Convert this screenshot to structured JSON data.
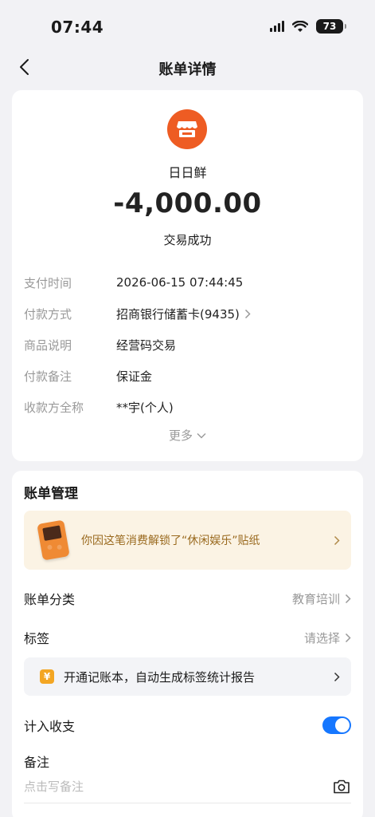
{
  "status_bar": {
    "time": "07:44",
    "battery": "73"
  },
  "nav": {
    "title": "账单详情",
    "back_icon": "chevron-left-icon"
  },
  "merchant": {
    "name": "日日鲜",
    "logo_icon": "storefront-icon",
    "logo_color": "#ee5c23"
  },
  "amount": "-4,000.00",
  "status": "交易成功",
  "details": [
    {
      "label": "支付时间",
      "value": "2026-06-15 07:44:45"
    },
    {
      "label": "付款方式",
      "value": "招商银行储蓄卡(9435)"
    },
    {
      "label": "商品说明",
      "value": "经营码交易"
    },
    {
      "label": "付款备注",
      "value": "保证金"
    },
    {
      "label": "收款方全称",
      "value": "**宇(个人)"
    }
  ],
  "more_label": "更多",
  "management": {
    "title": "账单管理",
    "sticker_text": "你因这笔消费解锁了“休闲娱乐”贴纸",
    "category": {
      "label": "账单分类",
      "value": "教育培训"
    },
    "tag": {
      "label": "标签",
      "value": "请选择"
    },
    "ledger_banner": "开通记账本，自动生成标签统计报告",
    "include": {
      "label": "计入收支",
      "enabled": true
    },
    "note": {
      "label": "备注",
      "placeholder": "点击写备注"
    }
  },
  "colors": {
    "accent": "#1677ff",
    "sticker_text": "#9a6a1f",
    "coin": "#f3a623"
  }
}
